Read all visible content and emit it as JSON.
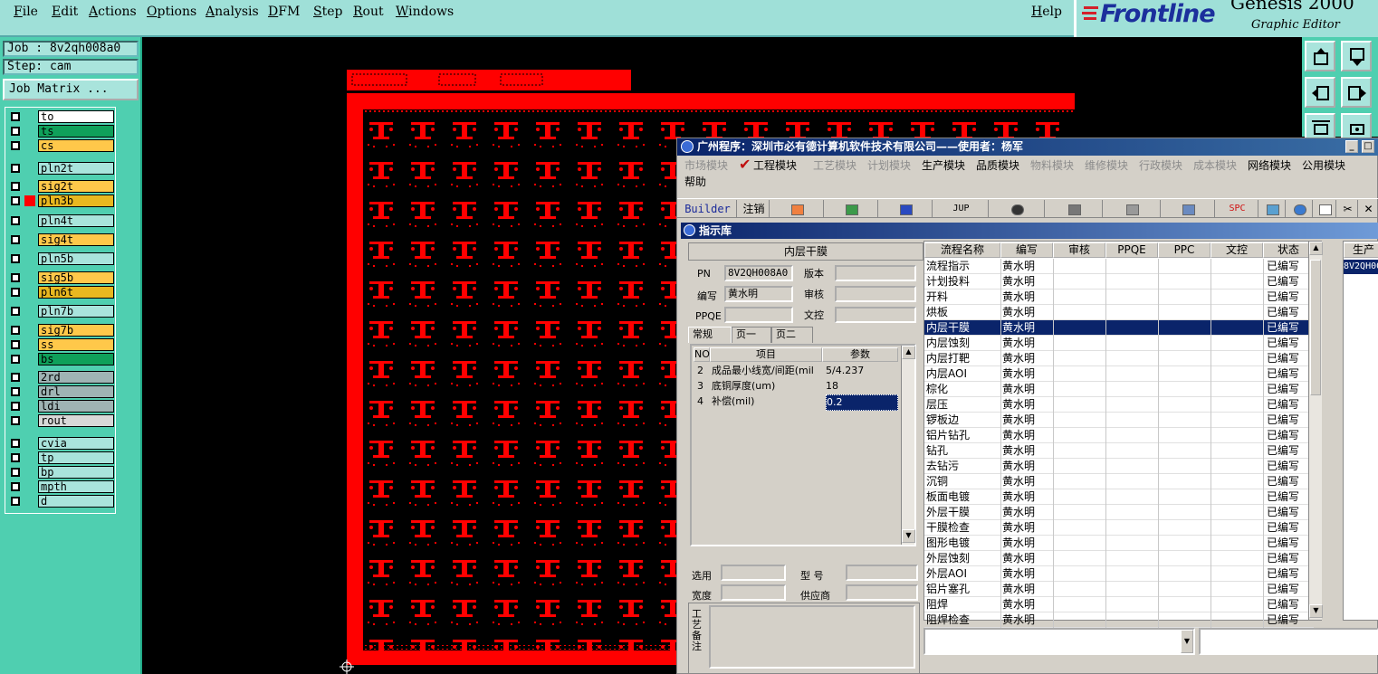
{
  "menubar": {
    "items": [
      "File",
      "Edit",
      "Actions",
      "Options",
      "Analysis",
      "DFM",
      "Step",
      "Rout",
      "Windows"
    ],
    "help": "Help"
  },
  "brand": {
    "logo": "Frontline",
    "product": "Genesis 2000",
    "subtitle": "Graphic Editor",
    "colors": {
      "logo": "#1b2f9c",
      "panel": "#9fe0d8"
    }
  },
  "job": {
    "job_label": "Job : 8v2qh008a0",
    "step_label": "Step: cam",
    "matrix_button": "Job Matrix ..."
  },
  "layers": [
    {
      "name": "to",
      "color": "#ffffff",
      "group": 0
    },
    {
      "name": "ts",
      "color": "#0fa05a",
      "group": 0
    },
    {
      "name": "cs",
      "color": "#ffc84a",
      "group": 0
    },
    {
      "name": "pln2t",
      "color": "#a9e4dc",
      "group": 1
    },
    {
      "name": "sig2t",
      "color": "#ffc84a",
      "group": 2
    },
    {
      "name": "pln3b",
      "color": "#e8b820",
      "group": 2,
      "active": true
    },
    {
      "name": "pln4t",
      "color": "#a9e4dc",
      "group": 3
    },
    {
      "name": "sig4t",
      "color": "#ffc84a",
      "group": 4
    },
    {
      "name": "pln5b",
      "color": "#a9e4dc",
      "group": 5
    },
    {
      "name": "sig5b",
      "color": "#ffc84a",
      "group": 6
    },
    {
      "name": "pln6t",
      "color": "#e8b820",
      "group": 6
    },
    {
      "name": "pln7b",
      "color": "#a9e4dc",
      "group": 7
    },
    {
      "name": "sig7b",
      "color": "#ffc84a",
      "group": 8
    },
    {
      "name": "ss",
      "color": "#ffc84a",
      "group": 8
    },
    {
      "name": "bs",
      "color": "#0fa05a",
      "group": 8
    },
    {
      "name": "2rd",
      "color": "#9fb4b4",
      "group": 9
    },
    {
      "name": "drl",
      "color": "#9fb4b4",
      "group": 9
    },
    {
      "name": "ldi",
      "color": "#9fb4b4",
      "group": 9
    },
    {
      "name": "rout",
      "color": "#d8d8d8",
      "group": 9
    },
    {
      "name": "cvia",
      "color": "#a9e4dc",
      "group": 10
    },
    {
      "name": "tp",
      "color": "#a9e4dc",
      "group": 10
    },
    {
      "name": "bp",
      "color": "#a9e4dc",
      "group": 10
    },
    {
      "name": "mpth",
      "color": "#a9e4dc",
      "group": 10
    },
    {
      "name": "d",
      "color": "#a9e4dc",
      "group": 10
    }
  ],
  "app": {
    "title": "广州程序：深圳市必有德计算机软件技术有限公司——使用者：杨军",
    "menu": [
      {
        "label": "市场模块",
        "enabled": false
      },
      {
        "label": "工程模块",
        "enabled": true,
        "checked": true
      },
      {
        "label": "工艺模块",
        "enabled": false
      },
      {
        "label": "计划模块",
        "enabled": false
      },
      {
        "label": "生产模块",
        "enabled": true
      },
      {
        "label": "品质模块",
        "enabled": true
      },
      {
        "label": "物料模块",
        "enabled": false
      },
      {
        "label": "维修模块",
        "enabled": false
      },
      {
        "label": "行政模块",
        "enabled": false
      },
      {
        "label": "成本模块",
        "enabled": false
      },
      {
        "label": "网络模块",
        "enabled": true
      },
      {
        "label": "公用模块",
        "enabled": true
      }
    ],
    "help": "帮助",
    "toolbar": {
      "builder": "Builder",
      "logout": "注销",
      "jup": "JUP",
      "spc": "SPC"
    }
  },
  "inner": {
    "title": "指示库",
    "form_heading": "内层干膜",
    "labels": {
      "pn": "PN",
      "version": "版本",
      "editor": "编写",
      "review": "审核",
      "ppqe": "PPQE",
      "doc": "文控"
    },
    "values": {
      "pn": "8V2QH008A0",
      "editor": "黄水明"
    },
    "tabs": [
      "常规",
      "页一",
      "页二"
    ],
    "param_headers": [
      "NO",
      "项目",
      "参数"
    ],
    "params": [
      {
        "no": "2",
        "item": "成品最小线宽/间距(mil",
        "value": "5/4.237"
      },
      {
        "no": "3",
        "item": "底铜厚度(um)",
        "value": "18"
      },
      {
        "no": "4",
        "item": "补偿(mil)",
        "value": "0.2"
      }
    ],
    "bottom_labels": {
      "select": "选用",
      "model": "型  号",
      "width": "宽度",
      "supplier": "供应商",
      "note": "工艺备注"
    }
  },
  "grid": {
    "headers": [
      "流程名称",
      "编写",
      "审核",
      "PPQE",
      "PPC",
      "文控",
      "状态"
    ],
    "rows": [
      [
        "流程指示",
        "黄水明",
        "已编写"
      ],
      [
        "计划投料",
        "黄水明",
        "已编写"
      ],
      [
        "开料",
        "黄水明",
        "已编写"
      ],
      [
        "烘板",
        "黄水明",
        "已编写"
      ],
      [
        "内层干膜",
        "黄水明",
        "已编写"
      ],
      [
        "内层蚀刻",
        "黄水明",
        "已编写"
      ],
      [
        "内层打靶",
        "黄水明",
        "已编写"
      ],
      [
        "内层AOI",
        "黄水明",
        "已编写"
      ],
      [
        "棕化",
        "黄水明",
        "已编写"
      ],
      [
        "层压",
        "黄水明",
        "已编写"
      ],
      [
        "锣板边",
        "黄水明",
        "已编写"
      ],
      [
        "铝片钻孔",
        "黄水明",
        "已编写"
      ],
      [
        "钻孔",
        "黄水明",
        "已编写"
      ],
      [
        "去钻污",
        "黄水明",
        "已编写"
      ],
      [
        "沉铜",
        "黄水明",
        "已编写"
      ],
      [
        "板面电镀",
        "黄水明",
        "已编写"
      ],
      [
        "外层干膜",
        "黄水明",
        "已编写"
      ],
      [
        "干膜检查",
        "黄水明",
        "已编写"
      ],
      [
        "图形电镀",
        "黄水明",
        "已编写"
      ],
      [
        "外层蚀刻",
        "黄水明",
        "已编写"
      ],
      [
        "外层AOI",
        "黄水明",
        "已编写"
      ],
      [
        "铝片塞孔",
        "黄水明",
        "已编写"
      ],
      [
        "阻焊",
        "黄水明",
        "已编写"
      ],
      [
        "阻焊检查",
        "黄水明",
        "已编写"
      ]
    ],
    "selected_index": 4,
    "right_header": "生产",
    "right_value": "8V2QH00"
  }
}
